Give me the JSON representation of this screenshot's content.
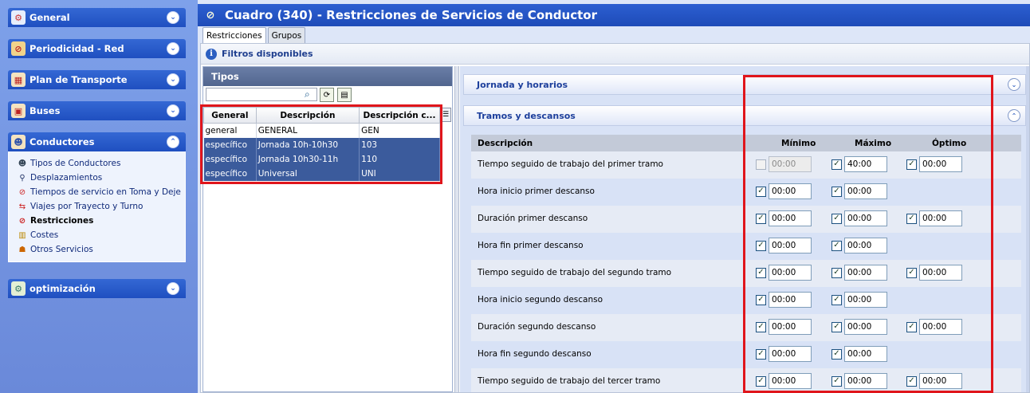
{
  "sidebar": {
    "panels": [
      {
        "title": "General",
        "icon": "general-icon",
        "expanded": false
      },
      {
        "title": "Periodicidad - Red",
        "icon": "calendar-icon",
        "expanded": false
      },
      {
        "title": "Plan de Transporte",
        "icon": "plan-icon",
        "expanded": false
      },
      {
        "title": "Buses",
        "icon": "bus-icon",
        "expanded": false
      },
      {
        "title": "Conductores",
        "icon": "driver-icon",
        "expanded": true
      },
      {
        "title": "optimización",
        "icon": "optimization-icon",
        "expanded": false
      }
    ],
    "conductores_items": [
      {
        "label": "Tipos de Conductores",
        "bold": false
      },
      {
        "label": "Desplazamientos",
        "bold": false
      },
      {
        "label": "Tiempos de servicio en Toma y Deje",
        "bold": false
      },
      {
        "label": "Viajes por Trayecto y Turno",
        "bold": false
      },
      {
        "label": "Restricciones",
        "bold": true
      },
      {
        "label": "Costes",
        "bold": false
      },
      {
        "label": "Otros Servicios",
        "bold": false
      }
    ]
  },
  "window": {
    "title": "Cuadro (340) - Restricciones de Servicios de Conductor"
  },
  "tabs": [
    {
      "label": "Restricciones",
      "active": true
    },
    {
      "label": "Grupos",
      "active": false
    }
  ],
  "filters": {
    "label": "Filtros disponibles"
  },
  "tipos": {
    "header": "Tipos",
    "search_value": "",
    "columns": [
      "General",
      "Descripción",
      "Descripción c..."
    ],
    "rows": [
      {
        "general": "general",
        "descripcion": "GENERAL",
        "desc_corta": "GEN",
        "selected": false
      },
      {
        "general": "específico",
        "descripcion": "Jornada 10h-10h30",
        "desc_corta": "103",
        "selected": true
      },
      {
        "general": "específico",
        "descripcion": "Jornada 10h30-11h",
        "desc_corta": "110",
        "selected": true
      },
      {
        "general": "específico",
        "descripcion": "Universal",
        "desc_corta": "UNI",
        "selected": true
      }
    ]
  },
  "sections": {
    "jornada": "Jornada y horarios",
    "tramos": "Tramos y descansos"
  },
  "restricciones": {
    "headers": {
      "descripcion": "Descripción",
      "minimo": "Mínimo",
      "maximo": "Máximo",
      "optimo": "Óptimo"
    },
    "rows": [
      {
        "label": "Tiempo seguido de trabajo del primer tramo",
        "min": "00:00",
        "min_checked": false,
        "min_disabled": true,
        "max": "40:00",
        "max_checked": true,
        "opt": "00:00",
        "opt_checked": true
      },
      {
        "label": "Hora inicio primer descanso",
        "min": "00:00",
        "min_checked": true,
        "max": "00:00",
        "max_checked": true
      },
      {
        "label": "Duración primer descanso",
        "min": "00:00",
        "min_checked": true,
        "max": "00:00",
        "max_checked": true,
        "opt": "00:00",
        "opt_checked": true
      },
      {
        "label": "Hora fin primer descanso",
        "min": "00:00",
        "min_checked": true,
        "max": "00:00",
        "max_checked": true
      },
      {
        "label": "Tiempo seguido de trabajo del segundo tramo",
        "min": "00:00",
        "min_checked": true,
        "max": "00:00",
        "max_checked": true,
        "opt": "00:00",
        "opt_checked": true
      },
      {
        "label": "Hora inicio segundo descanso",
        "min": "00:00",
        "min_checked": true,
        "max": "00:00",
        "max_checked": true
      },
      {
        "label": "Duración segundo descanso",
        "min": "00:00",
        "min_checked": true,
        "max": "00:00",
        "max_checked": true,
        "opt": "00:00",
        "opt_checked": true
      },
      {
        "label": "Hora fin segundo descanso",
        "min": "00:00",
        "min_checked": true,
        "max": "00:00",
        "max_checked": true
      },
      {
        "label": "Tiempo seguido de trabajo del tercer tramo",
        "min": "00:00",
        "min_checked": true,
        "max": "00:00",
        "max_checked": true,
        "opt": "00:00",
        "opt_checked": true
      }
    ]
  },
  "colors": {
    "highlight_outline": "#e0151b",
    "selected_row": "#3b5b9c",
    "title_bar": "#2c5fd1"
  }
}
